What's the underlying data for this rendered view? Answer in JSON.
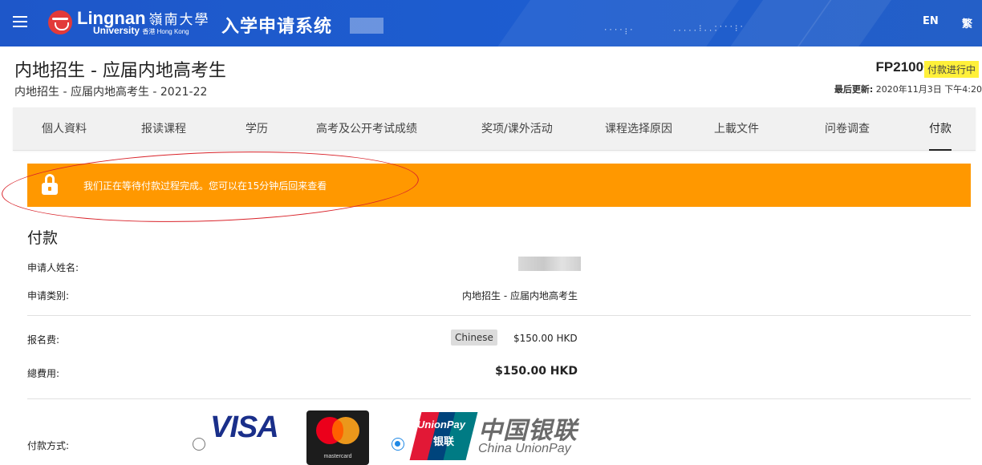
{
  "topbar": {
    "logo_name": "Lingnan",
    "logo_cn": "嶺南大學",
    "logo_sub": "University",
    "logo_sub_small": "香港 Hong Kong",
    "system_title": "入学申请系统",
    "lang_en": "EN",
    "lang_tc": "繁",
    "bg_color": "#1e57c9"
  },
  "header": {
    "title": "内地招生 - 应届内地高考生",
    "subtitle": "内地招生 - 应届内地高考生 - 2021-22",
    "app_id": "FP210001",
    "status": "付款进行中",
    "last_update_label": "最后更新:",
    "last_update_value": "2020年11月3日 下午4:20"
  },
  "tabs": [
    {
      "label": "個人資料"
    },
    {
      "label": "报读课程"
    },
    {
      "label": "学历"
    },
    {
      "label": "高考及公开考试成绩"
    },
    {
      "label": "奖项/课外活动"
    },
    {
      "label": "课程选择原因"
    },
    {
      "label": "上載文件"
    },
    {
      "label": "问卷调查"
    },
    {
      "label": "付款",
      "active": true
    }
  ],
  "alert": {
    "icon": "lock-icon",
    "message": "我们正在等待付款过程完成。您可以在15分钟后回来查看",
    "color": "#ff9800"
  },
  "payment": {
    "section_title": "付款",
    "applicant_name_label": "申请人姓名:",
    "category_label": "申请类别:",
    "category_value": "内地招生 - 应届内地高考生",
    "fee_label": "报名费:",
    "fee_chip": "Chinese",
    "fee_value": "$150.00 HKD",
    "total_label": "總費用:",
    "total_value": "$150.00 HKD",
    "method_label": "付款方式:",
    "methods": [
      {
        "name": "VISA",
        "selected": false
      },
      {
        "name": "mastercard",
        "selected": false
      },
      {
        "name": "UnionPay",
        "selected": true
      }
    ],
    "unionpay_logo_top": "UnionPay",
    "unionpay_logo_cn": "银联",
    "unionpay_cn": "中国银联",
    "unionpay_en": "China UnionPay"
  }
}
